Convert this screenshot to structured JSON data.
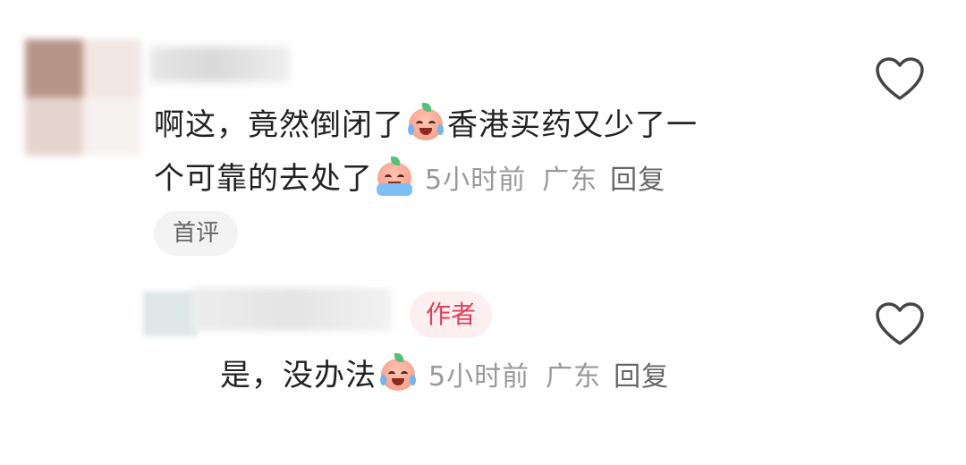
{
  "comments": [
    {
      "text_part1": "啊这，竟然倒闭了",
      "emoji1": "crying-face-emoji",
      "text_part2": "香港买药又少了一",
      "text_part3": "个可靠的去处了",
      "emoji2": "flood-crying-face-emoji",
      "time": "5小时前",
      "location": "广东",
      "reply": "回复",
      "badge": "首评",
      "like_icon": "heart-outline-icon"
    },
    {
      "author_badge": "作者",
      "text": "是，没办法",
      "emoji": "crying-face-emoji",
      "time": "5小时前",
      "location": "广东",
      "reply": "回复",
      "like_icon": "heart-outline-icon"
    }
  ],
  "colors": {
    "text": "#222222",
    "meta": "#999999",
    "author_badge_text": "#e2405a",
    "author_badge_bg": "#fdeef0",
    "first_badge_bg": "#f3f3f3",
    "heart": "#444444"
  }
}
